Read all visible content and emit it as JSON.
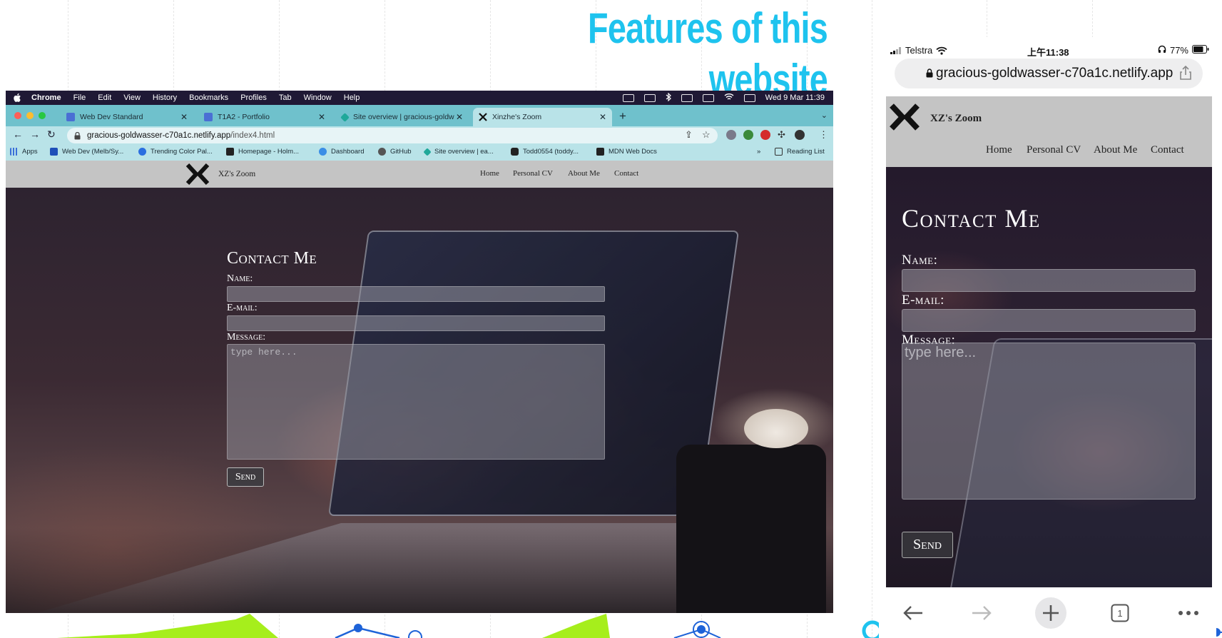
{
  "slide": {
    "title": "Features of this website",
    "title_color": "#1ec3ee",
    "accent_green": "#a6ee1c",
    "accent_blue": "#1e63d8"
  },
  "mac_menubar": {
    "apple_icon": "apple-logo-icon",
    "items": [
      "Chrome",
      "File",
      "Edit",
      "View",
      "History",
      "Bookmarks",
      "Profiles",
      "Tab",
      "Window",
      "Help"
    ],
    "clock": "Wed 9 Mar  11:39"
  },
  "chrome": {
    "tabs": [
      {
        "label": "Web Dev Standard",
        "icon": "doc-icon"
      },
      {
        "label": "T1A2 - Portfolio",
        "icon": "doc-icon"
      },
      {
        "label": "Site overview | gracious-goldw",
        "icon": "netlify-icon"
      },
      {
        "label": "Xinzhe's Zoom",
        "icon": "xz-logo-icon"
      }
    ],
    "new_tab": "+",
    "address": {
      "domain": "gracious-goldwasser-c70a1c.netlify.app",
      "path": "/index4.html"
    },
    "bookmarks": [
      {
        "label": "Apps"
      },
      {
        "label": "Web Dev (Melb/Sy..."
      },
      {
        "label": "Trending Color Pal..."
      },
      {
        "label": "Homepage - Holm..."
      },
      {
        "label": "Dashboard"
      },
      {
        "label": "GitHub"
      },
      {
        "label": "Site overview | ea..."
      },
      {
        "label": "Todd0554 (toddy..."
      },
      {
        "label": "MDN Web Docs"
      }
    ],
    "bookmarks_more": "»",
    "reading_list": "Reading List",
    "tab_bg": "#6fc1cc",
    "toolbar_bg": "#b9e3e8"
  },
  "site": {
    "brand": "XZ's Zoom",
    "nav": [
      "Home",
      "Personal CV",
      "About Me",
      "Contact"
    ],
    "contact_title": "Contact Me",
    "name_label": "Name:",
    "email_label": "E-mail:",
    "message_label": "Message:",
    "message_placeholder": "type here...",
    "send_label": "Send"
  },
  "phone": {
    "carrier": "Telstra",
    "time": "上午11:38",
    "battery": "77%",
    "url": "gracious-goldwasser-c70a1c.netlify.app"
  }
}
